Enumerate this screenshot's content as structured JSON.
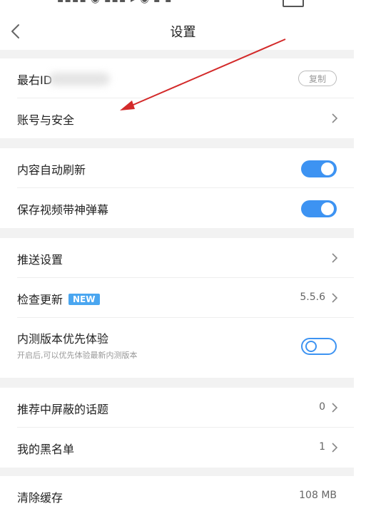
{
  "status_bar": {
    "battery_icon": "battery-icon"
  },
  "header": {
    "title": "设置",
    "back_icon": "chevron-left-icon"
  },
  "account": {
    "id_label": "最右ID",
    "copy_label": "复制",
    "security_label": "账号与安全"
  },
  "content": {
    "auto_refresh_label": "内容自动刷新",
    "auto_refresh_on": true,
    "save_video_danmaku_label": "保存视频带神弹幕",
    "save_video_danmaku_on": true
  },
  "updates": {
    "push_label": "推送设置",
    "check_update_label": "检查更新",
    "new_badge": "NEW",
    "version": "5.5.6",
    "beta_label": "内测版本优先体验",
    "beta_desc": "开启后,可以优先体验最新内测版本",
    "beta_on": false
  },
  "privacy": {
    "blocked_topics_label": "推荐中屏蔽的话题",
    "blocked_topics_count": "0",
    "blacklist_label": "我的黑名单",
    "blacklist_count": "1"
  },
  "storage": {
    "clear_cache_label": "清除缓存",
    "cache_size": "108 MB"
  },
  "colors": {
    "accent": "#3d93f2",
    "annotation_arrow": "#d32a2a",
    "divider": "#f2f2f2"
  }
}
